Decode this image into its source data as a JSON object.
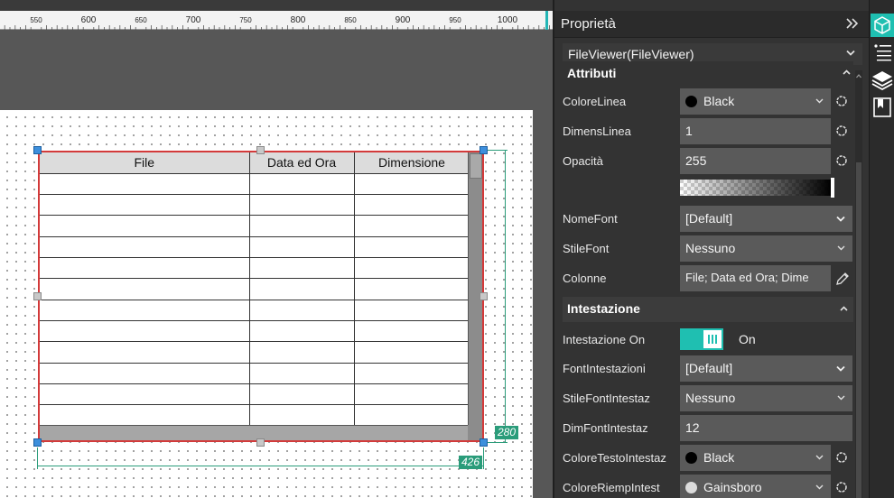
{
  "ruler": {
    "labels": [
      "550",
      "600",
      "650",
      "700",
      "750",
      "800",
      "850",
      "900",
      "950",
      "1000"
    ]
  },
  "fileviewer": {
    "columns": [
      "File",
      "Data ed Ora",
      "Dimensione"
    ],
    "height_label": "280",
    "width_label": "426"
  },
  "panel": {
    "title": "Proprietà",
    "component": "FileViewer(FileViewer)",
    "sections": {
      "attributi": "Attributi",
      "intestazione": "Intestazione"
    },
    "props": {
      "colore_linea": {
        "label": "ColoreLinea",
        "value": "Black",
        "color": "#000000"
      },
      "dimens_linea": {
        "label": "DimensLinea",
        "value": "1"
      },
      "opacita": {
        "label": "Opacità",
        "value": "255"
      },
      "nome_font": {
        "label": "NomeFont",
        "value": "[Default]"
      },
      "stile_font": {
        "label": "StileFont",
        "value": "Nessuno"
      },
      "colonne": {
        "label": "Colonne",
        "value": "File; Data ed Ora; Dime"
      },
      "intestazione_on": {
        "label": "Intestazione On",
        "value": "On"
      },
      "font_intestazioni": {
        "label": "FontIntestazioni",
        "value": "[Default]"
      },
      "stile_font_intestaz": {
        "label": "StileFontIntestaz",
        "value": "Nessuno"
      },
      "dim_font_intestaz": {
        "label": "DimFontIntestaz",
        "value": "12"
      },
      "colore_testo_intestaz": {
        "label": "ColoreTestoIntestaz",
        "value": "Black",
        "color": "#000000"
      },
      "colore_riemp_intest": {
        "label": "ColoreRiempIntest",
        "value": "Gainsboro",
        "color": "#dcdcdc"
      }
    }
  },
  "toolbar": {
    "icons": [
      "cube-icon",
      "list-icon",
      "layers-icon",
      "bookmark-icon"
    ]
  },
  "colors": {
    "accent": "#1fbfb1",
    "selection_border": "#d33a3a",
    "dimension": "#2a9c7a",
    "handle": "#3d8fdc"
  }
}
